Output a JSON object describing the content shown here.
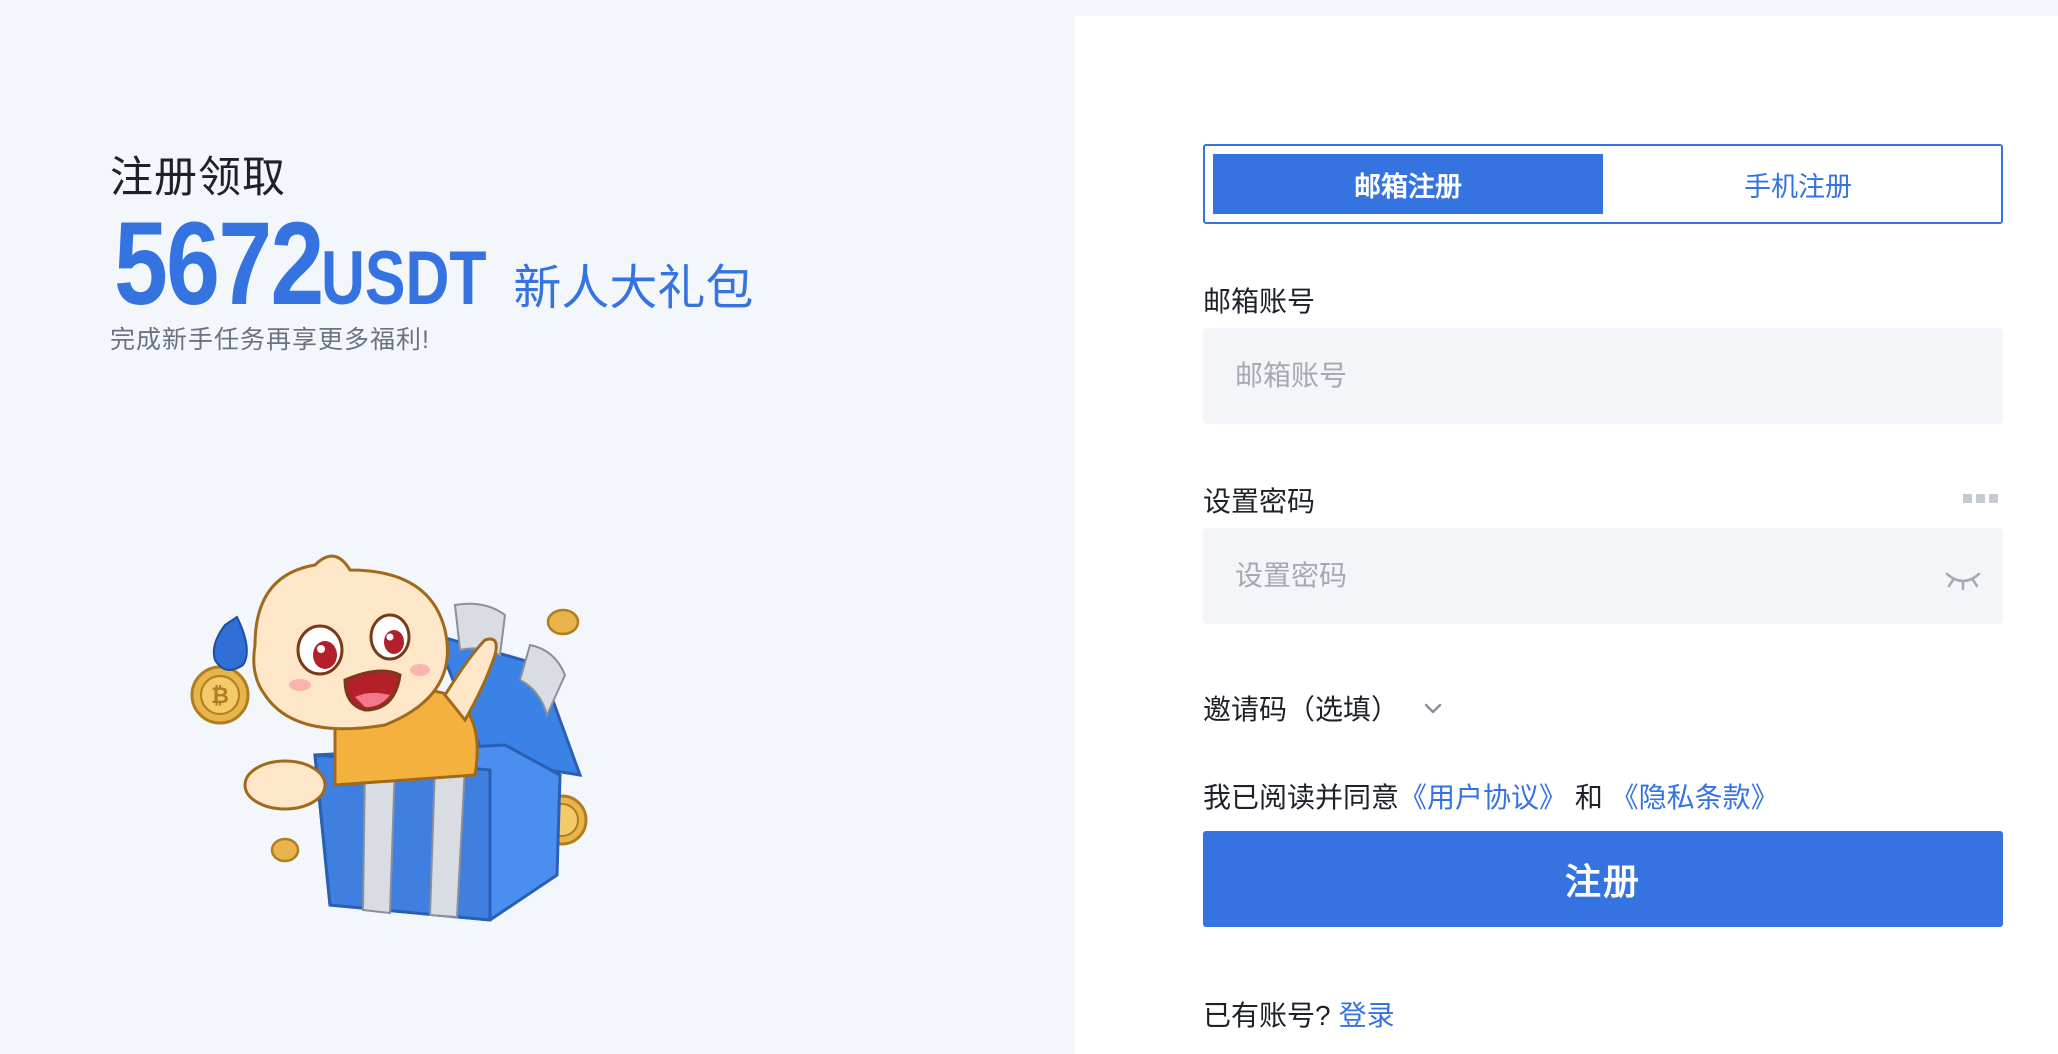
{
  "promo": {
    "kicker": "注册领取",
    "amount": "5672",
    "unit": "USDT",
    "gift": "新人大礼包",
    "subtitle": "完成新手任务再享更多福利!"
  },
  "tabs": [
    {
      "label": "邮箱注册",
      "active": true
    },
    {
      "label": "手机注册",
      "active": false
    }
  ],
  "email": {
    "label": "邮箱账号",
    "placeholder": "邮箱账号",
    "value": ""
  },
  "password": {
    "label": "设置密码",
    "placeholder": "设置密码",
    "value": ""
  },
  "invite": {
    "label": "邀请码（选填）"
  },
  "agreement": {
    "prefix": "我已阅读并同意",
    "user_terms": "《用户协议》",
    "conjunction": "和",
    "privacy": "《隐私条款》"
  },
  "submit_label": "注册",
  "login": {
    "prompt": "已有账号?",
    "link": "登录"
  },
  "colors": {
    "accent": "#3574e0",
    "background": "#f3f6fa",
    "panel": "#ffffff",
    "input_bg": "#f3f5f8"
  },
  "icons": [
    "mascot-illustration",
    "password-strength-dots-icon",
    "eye-closed-icon",
    "chevron-down-icon"
  ]
}
